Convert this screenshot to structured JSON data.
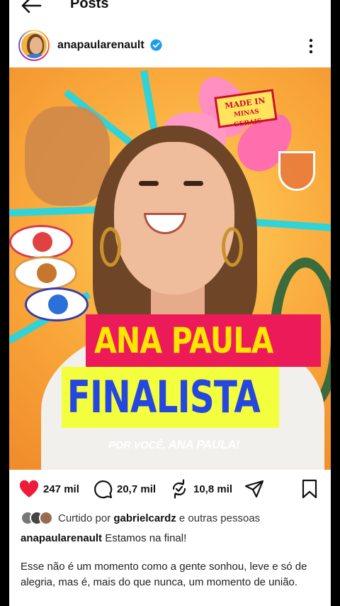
{
  "header": {
    "title": "Posts",
    "back_icon": "arrow-left-icon"
  },
  "account": {
    "username": "anapaularenault",
    "verified": true,
    "more_icon": "more-vertical-icon"
  },
  "post_image": {
    "headline_1": "ANA PAULA",
    "headline_2": "FINALISTA",
    "tagline_prefix": "POR VOCÊ,",
    "tagline_name": "ANA PAULA!",
    "stamp_line_1": "MADE IN",
    "stamp_line_2": "MINAS GERAIS",
    "colors": {
      "background": "#f9a63a",
      "ribbon_1": "#ed1a5a",
      "ribbon_1_text": "#ffe600",
      "ribbon_2": "#f3ff3c",
      "ribbon_2_text": "#2646e0"
    }
  },
  "actions": {
    "likes": "247 mil",
    "comments": "20,7 mil",
    "reposts": "10,8 mil",
    "like_color": "#ed1c3a"
  },
  "liked_by": {
    "prefix": "Curtido por",
    "user": "gabrielcardz",
    "suffix": "e outras pessoas"
  },
  "caption": {
    "username": "anapaularenault",
    "first_line": "Estamos na final!",
    "paragraph": "Esse não é um momento como a gente sonhou, leve e só de alegria, mas é, mais do que nunca, um momento de união."
  }
}
